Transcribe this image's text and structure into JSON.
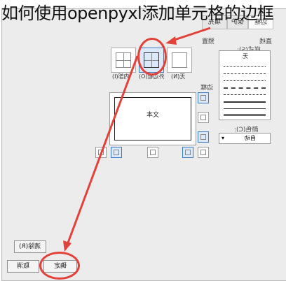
{
  "title": "如何使用openpyxl添加单元格的边框",
  "tabs": [
    "边框",
    "填充",
    "保护"
  ],
  "presets": {
    "section_label": "预置",
    "items": [
      {
        "label": "内部(I)"
      },
      {
        "label": "外边框(O)"
      },
      {
        "label": "无(N)"
      }
    ]
  },
  "border_section_label": "边框",
  "preview_text": "文本",
  "line": {
    "section_label": "直线",
    "style_label": "样式(S):",
    "none_label": "无",
    "color_label": "颜色(C):",
    "color_value": "自动"
  },
  "buttons": {
    "clear": "清除(R)",
    "ok": "确定",
    "cancel": "取消"
  },
  "colors": {
    "highlight": "#e2423a",
    "accent": "#3a79c4"
  }
}
